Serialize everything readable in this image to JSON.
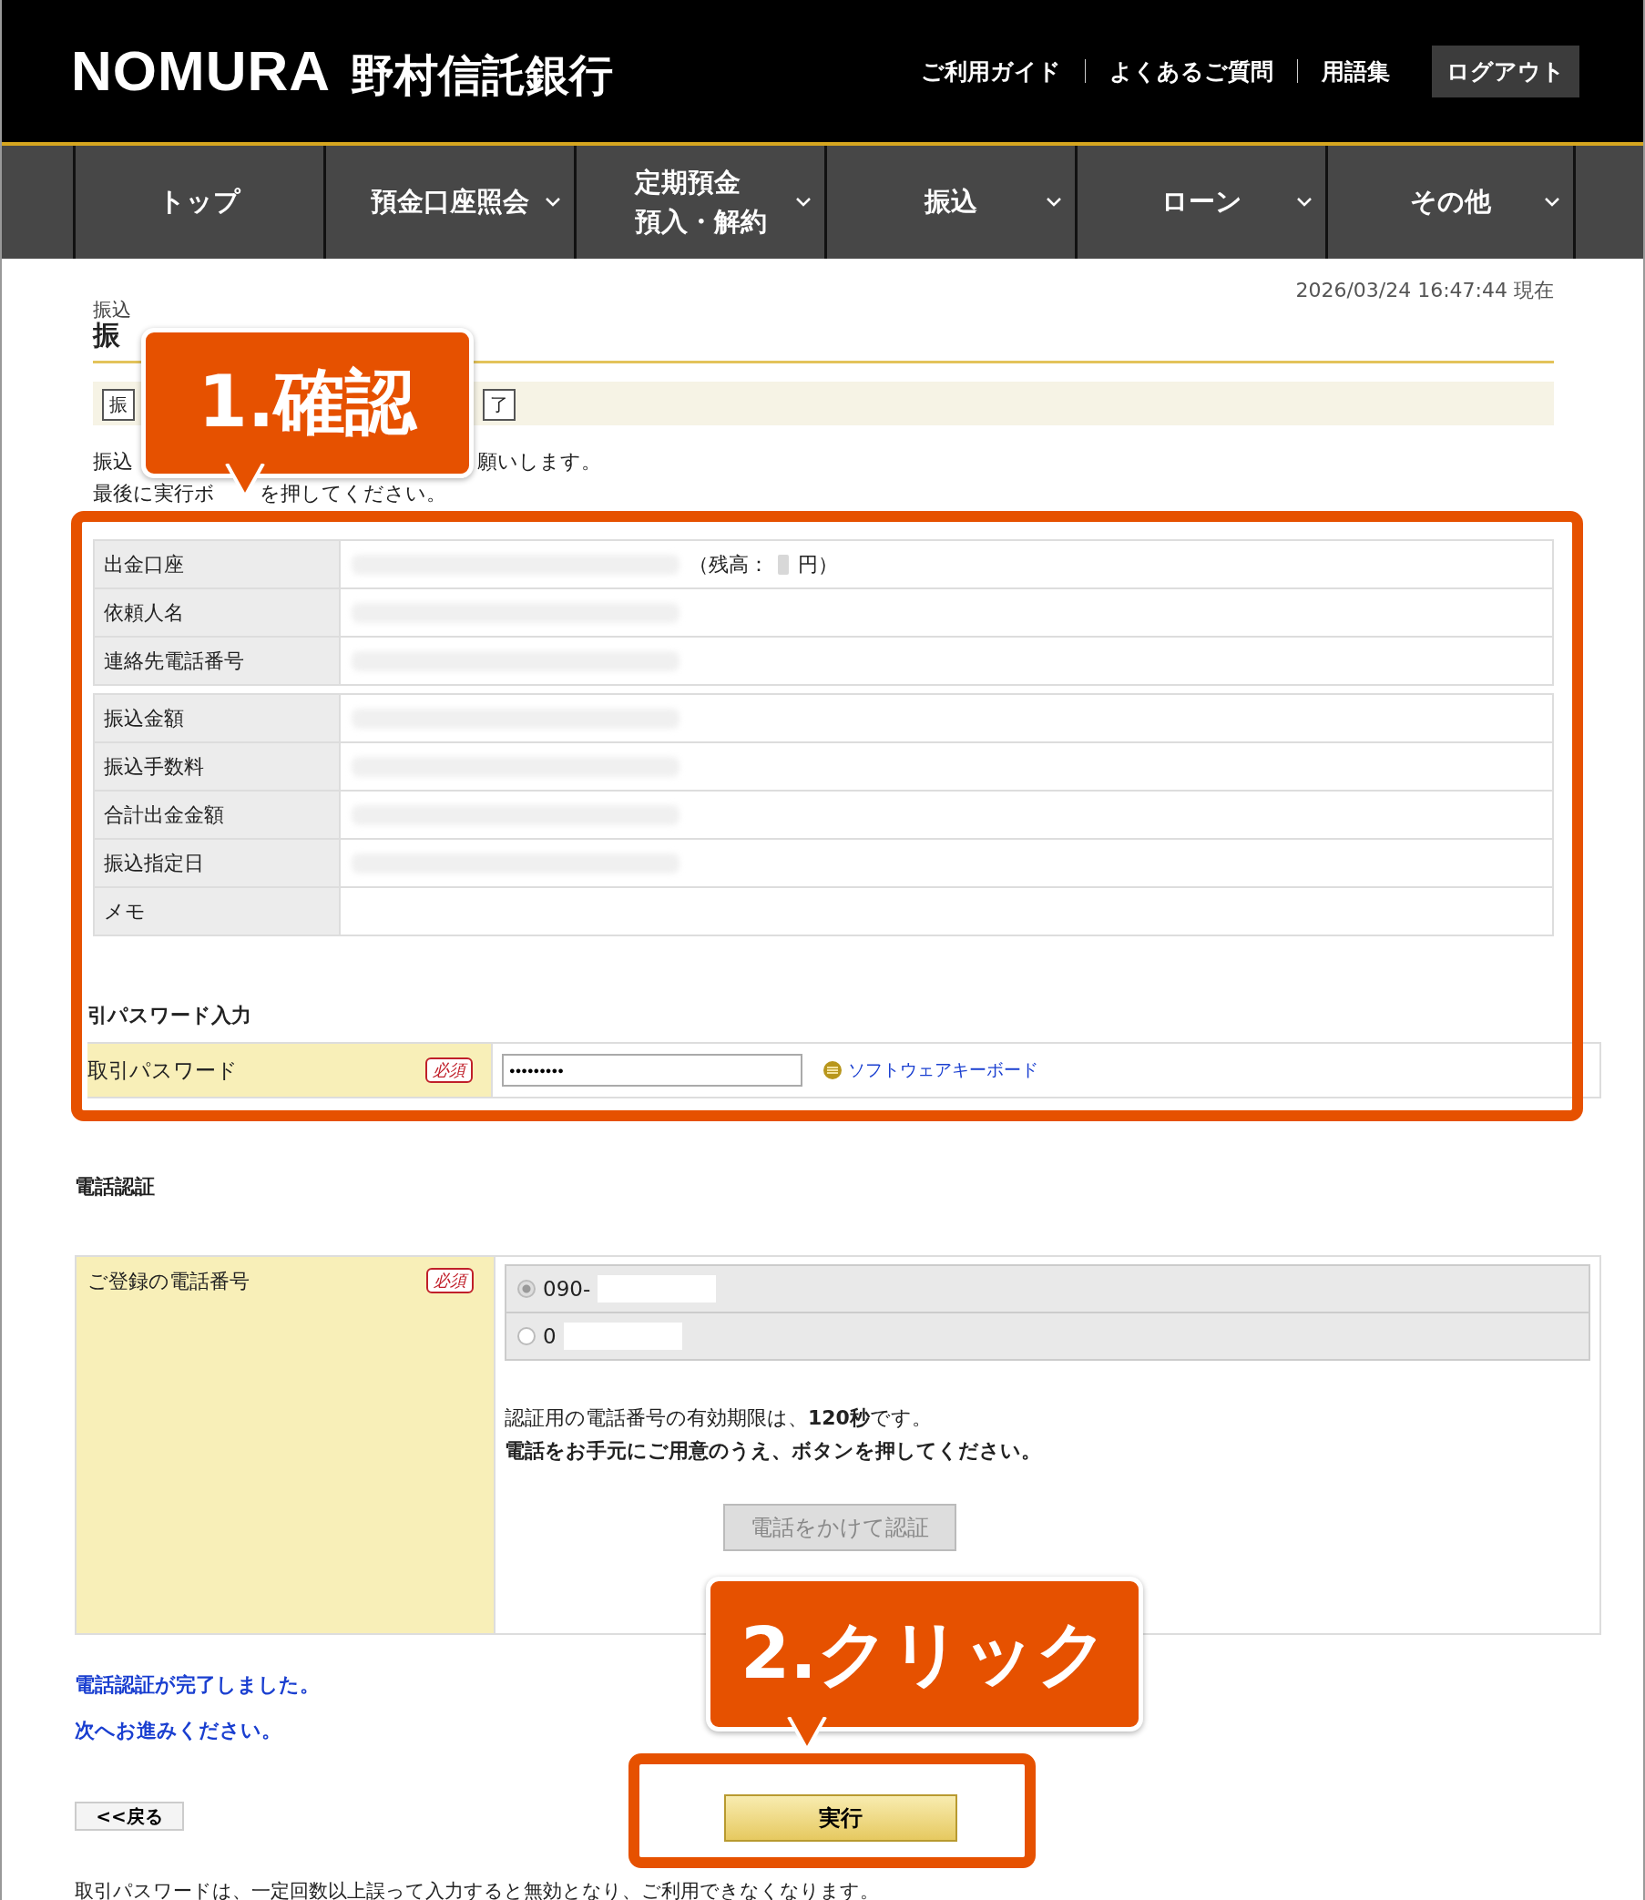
{
  "header": {
    "logo_latin": "NOMURA",
    "logo_name": "野村信託銀行",
    "links": [
      "ご利用ガイド",
      "よくあるご質問",
      "用語集"
    ],
    "logout": "ログアウト"
  },
  "nav": [
    {
      "lines": [
        "トップ"
      ],
      "dropdown": false
    },
    {
      "lines": [
        "預金口座照会"
      ],
      "dropdown": true
    },
    {
      "lines": [
        "定期預金",
        "預入・解約"
      ],
      "dropdown": true
    },
    {
      "lines": [
        "振込"
      ],
      "dropdown": true
    },
    {
      "lines": [
        "ローン"
      ],
      "dropdown": true
    },
    {
      "lines": [
        "その他"
      ],
      "dropdown": true
    }
  ],
  "timestamp": "2026/03/24  16:47:44 現在",
  "breadcrumb": "振込",
  "page_title": "振",
  "steps": [
    "振",
    "了"
  ],
  "instructions": [
    {
      "before": "振込",
      "after": "願いします。"
    },
    {
      "before": "最後に実行ボ",
      "after": "を押してください。"
    }
  ],
  "detail_groups": [
    [
      {
        "label": "出金口座",
        "masked": true,
        "balance_prefix": "（残高：",
        "balance_suffix": "円）"
      },
      {
        "label": "依頼人名",
        "masked": true
      },
      {
        "label": "連絡先電話番号",
        "masked": true
      }
    ],
    [
      {
        "label": "振込金額",
        "masked": true
      },
      {
        "label": "振込手数料",
        "masked": true
      },
      {
        "label": "合計出金金額",
        "masked": true
      },
      {
        "label": "振込指定日",
        "masked": true
      },
      {
        "label": "メモ",
        "masked": false
      }
    ]
  ],
  "password_section": {
    "title": "引パスワード入力",
    "label": "取引パスワード",
    "required": "必須",
    "value": "●●●●●●●●●",
    "keyboard_link": "ソフトウェアキーボード"
  },
  "phone_section": {
    "title": "電話認証",
    "label": "ご登録の電話番号",
    "required": "必須",
    "options": [
      {
        "prefix": "090-",
        "selected": true
      },
      {
        "prefix": "0",
        "selected": false
      }
    ],
    "note": [
      "認証用の電話番号の有効期限は、**120秒**です。",
      "電話をお手元にご用意のうえ、ボタンを押してください。"
    ],
    "call_button": {
      "label": "電話をかけて認証",
      "disabled": true
    }
  },
  "completion": [
    "電話認証が完了しました。",
    "次へお進みください。"
  ],
  "back_button": "<<戻る",
  "execute_button": "実行",
  "footer_note": "取引パスワードは、一定回数以上誤って入力すると無効となり、ご利用できなくなります。",
  "annotations": [
    {
      "label": "1.確認"
    },
    {
      "label": "2.クリック"
    }
  ]
}
